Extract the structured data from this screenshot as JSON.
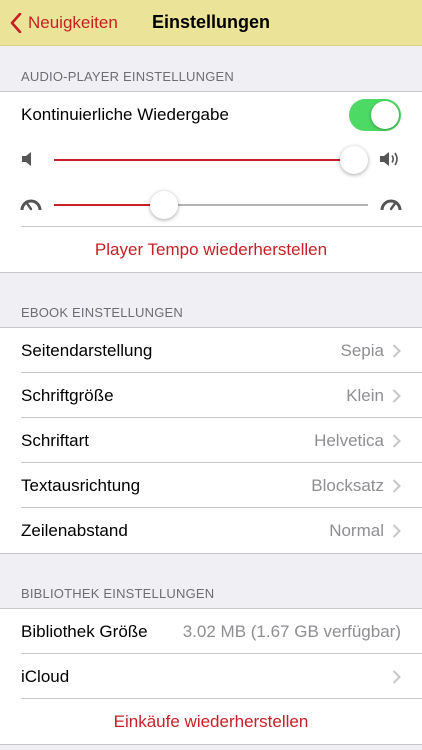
{
  "nav": {
    "back_label": "Neuigkeiten",
    "title": "Einstellungen"
  },
  "audio": {
    "header": "AUDIO-PLAYER EINSTELLUNGEN",
    "continuous_label": "Kontinuierliche Wiedergabe",
    "continuous_on": true,
    "volume_level": 0.955,
    "tempo_level": 0.35,
    "reset_tempo_label": "Player Tempo wiederherstellen"
  },
  "ebook": {
    "header": "EBOOK EINSTELLUNGEN",
    "rows": [
      {
        "label": "Seitendarstellung",
        "value": "Sepia"
      },
      {
        "label": "Schriftgröße",
        "value": "Klein"
      },
      {
        "label": "Schriftart",
        "value": "Helvetica"
      },
      {
        "label": "Textausrichtung",
        "value": "Blocksatz"
      },
      {
        "label": "Zeilenabstand",
        "value": "Normal"
      }
    ]
  },
  "library": {
    "header": "BIBLIOTHEK EINSTELLUNGEN",
    "size_label": "Bibliothek Größe",
    "size_value": "3.02 MB (1.67 GB verfügbar)",
    "icloud_label": "iCloud",
    "restore_label": "Einkäufe wiederherstellen"
  },
  "colors": {
    "accent": "#c62026",
    "navbar": "#ebe398",
    "toggle_on": "#4cd964"
  }
}
